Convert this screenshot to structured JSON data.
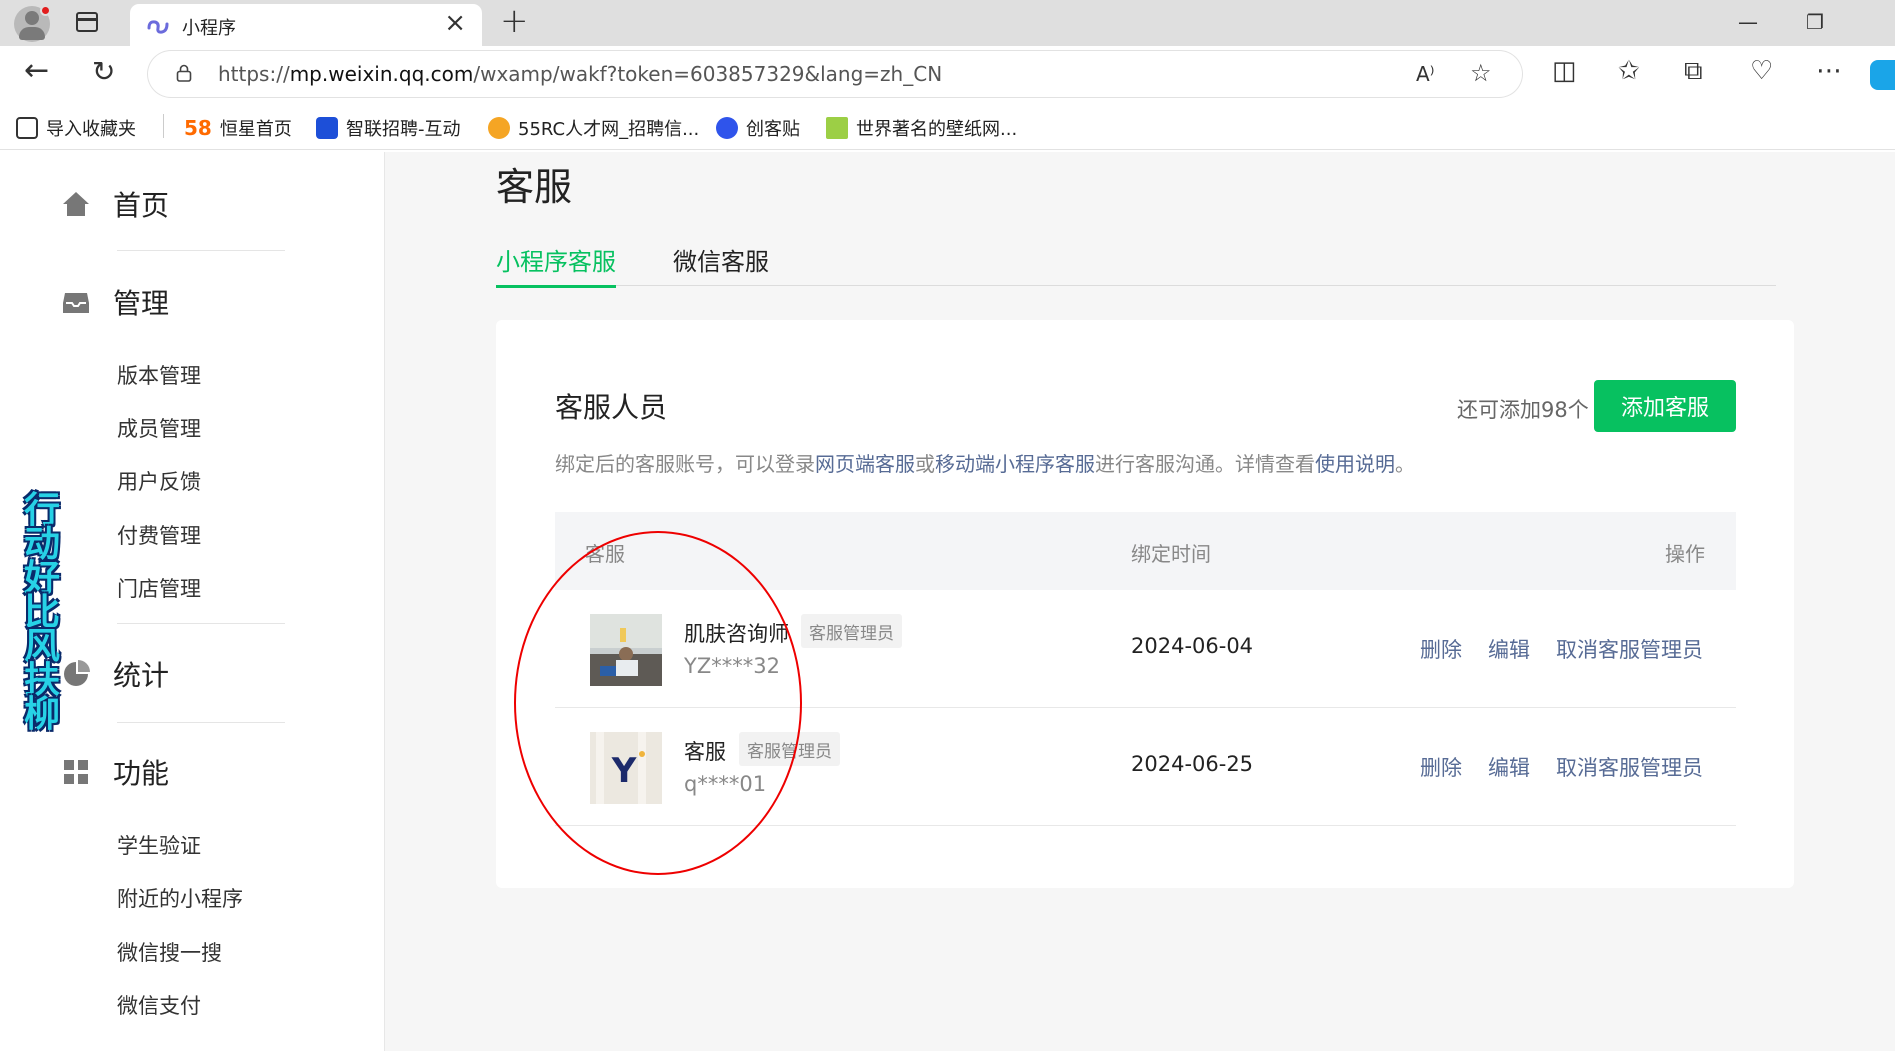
{
  "browser": {
    "tab_title": "小程序",
    "url_prefix": "https://",
    "url_host": "mp.weixin.qq.com",
    "url_path": "/wxamp/wakf?token=603857329&lang=zh_CN",
    "bookmarks": [
      {
        "label": "导入收藏夹",
        "icon": "folder-import-icon",
        "color": "#333333"
      },
      {
        "label": "恒星首页",
        "icon": "58-icon",
        "color": "#ff6a00"
      },
      {
        "label": "智联招聘-互动",
        "icon": "zhilian-icon",
        "color": "#1d4fd8"
      },
      {
        "label": "55RC人才网_招聘信...",
        "icon": "55rc-icon",
        "color": "#f5a524"
      },
      {
        "label": "创客贴",
        "icon": "chuangketie-icon",
        "color": "#2f54eb"
      },
      {
        "label": "世界著名的壁纸网...",
        "icon": "wallhaven-icon",
        "color": "#9ccf45"
      }
    ]
  },
  "sidebar": {
    "home": "首页",
    "manage": "管理",
    "manage_items": [
      "版本管理",
      "成员管理",
      "用户反馈",
      "付费管理",
      "门店管理"
    ],
    "stats": "统计",
    "features": "功能",
    "feature_items": [
      "学生验证",
      "附近的小程序",
      "微信搜一搜",
      "微信支付"
    ]
  },
  "watermark": "行动好比风扶柳",
  "page": {
    "title": "客服",
    "tabs": [
      "小程序客服",
      "微信客服"
    ],
    "active_tab": "小程序客服",
    "accent": "#07c160",
    "link_color": "#576b95"
  },
  "card": {
    "title": "客服人员",
    "remain": "还可添加98个",
    "add_button": "添加客服",
    "desc_parts": [
      "绑定后的客服账号，可以登录",
      "网页端客服",
      "或",
      "移动端小程序客服",
      "进行客服沟通。详情查看",
      "使用说明",
      "。"
    ],
    "columns": [
      "客服",
      "绑定时间",
      "操作"
    ],
    "rows": [
      {
        "name": "肌肤咨询师",
        "badge": "客服管理员",
        "account": "YZ****32",
        "date": "2024-06-04",
        "actions": [
          "删除",
          "编辑",
          "取消客服管理员"
        ]
      },
      {
        "name": "客服",
        "badge": "客服管理员",
        "account": "q****01",
        "date": "2024-06-25",
        "actions": [
          "删除",
          "编辑",
          "取消客服管理员"
        ]
      }
    ]
  },
  "annotation": {
    "shape": "ellipse",
    "color": "#ee0000"
  }
}
